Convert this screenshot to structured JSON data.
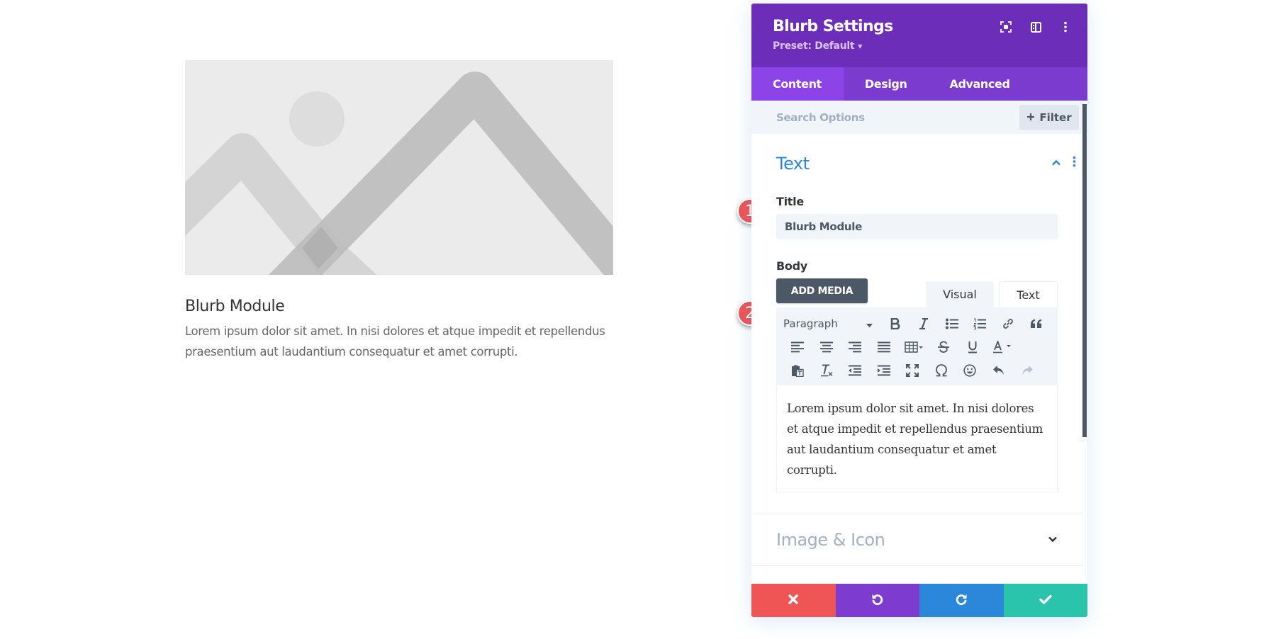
{
  "preview": {
    "title": "Blurb Module",
    "body": "Lorem ipsum dolor sit amet. In nisi dolores et atque impedit et repellendus praesentium aut laudantium consequatur et amet corrupti."
  },
  "panel": {
    "title": "Blurb Settings",
    "preset": "Preset: Default",
    "header_icons": [
      "expand-icon",
      "split-view-icon",
      "more-vertical-icon"
    ],
    "tabs": [
      {
        "label": "Content",
        "active": true
      },
      {
        "label": "Design",
        "active": false
      },
      {
        "label": "Advanced",
        "active": false
      }
    ],
    "search": {
      "placeholder": "Search Options",
      "value": ""
    },
    "filter_label": "Filter",
    "sections": {
      "text": {
        "title": "Text",
        "expanded": true,
        "title_label": "Title",
        "title_value": "Blurb Module",
        "body_label": "Body",
        "add_media": "ADD MEDIA",
        "editor_tabs": [
          {
            "label": "Visual",
            "active": true
          },
          {
            "label": "Text",
            "active": false
          }
        ],
        "format_select": "Paragraph",
        "toolbar": [
          [
            "bold-icon",
            "italic-icon",
            "bullet-list-icon",
            "numbered-list-icon",
            "link-icon",
            "blockquote-icon"
          ],
          [
            "align-left-icon",
            "align-center-icon",
            "align-right-icon",
            "align-justify-icon",
            "table-icon",
            "strikethrough-icon",
            "underline-icon",
            "text-color-icon"
          ],
          [
            "paste-as-text-icon",
            "clear-formatting-icon",
            "outdent-icon",
            "indent-icon",
            "fullscreen-icon",
            "special-character-icon",
            "emoji-icon",
            "undo-icon",
            "redo-icon"
          ]
        ],
        "body_value": "Lorem ipsum dolor sit amet. In nisi dolores et atque impedit et repellendus praesentium aut laudantium consequatur et amet corrupti."
      },
      "image_icon": {
        "title": "Image & Icon",
        "expanded": false
      }
    },
    "actions": [
      {
        "name": "cancel",
        "icon": "close-icon",
        "color": "#ef5555"
      },
      {
        "name": "undo",
        "icon": "undo-icon",
        "color": "#7e3bd0"
      },
      {
        "name": "redo",
        "icon": "redo-icon",
        "color": "#2b87da"
      },
      {
        "name": "save",
        "icon": "check-icon",
        "color": "#29c4a9"
      }
    ]
  },
  "annotations": [
    {
      "label": "1",
      "target": "title-input"
    },
    {
      "label": "2",
      "target": "body-editor"
    }
  ],
  "colors": {
    "header": "#6c2eb9",
    "tabs": "#7b3bce",
    "active_tab": "#8c43e8",
    "accent_blue": "#2b87da",
    "badge": "#ef5555"
  }
}
